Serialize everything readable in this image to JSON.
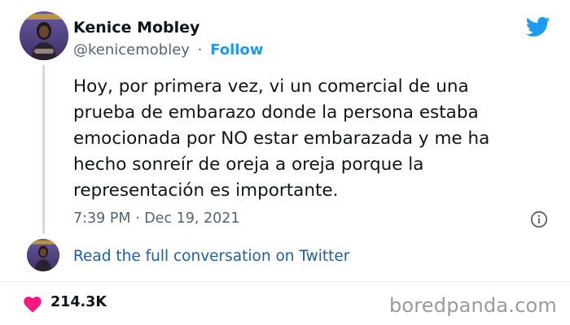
{
  "author": {
    "name": "Kenice Mobley",
    "handle": "@kenicemobley",
    "separator": "·",
    "follow_label": "Follow",
    "avatar_caption": "KENICE MOBLEY"
  },
  "tweet": {
    "text": "Hoy, por primera vez, vi un comercial de una prueba de embarazo donde la persona estaba emocionada por NO estar embarazada y me ha hecho sonreír de oreja a oreja porque la representación es importante.",
    "timestamp": "7:39 PM · Dec 19, 2021"
  },
  "conversation": {
    "link_label": "Read the full conversation on Twitter"
  },
  "stats": {
    "likes": "214.3K"
  },
  "watermark": "boredpanda.com",
  "icons": {
    "brand": "twitter-bird-icon",
    "info": "info-icon",
    "like": "heart-icon"
  },
  "colors": {
    "accent": "#1d9bf0",
    "link": "#1d5fa6",
    "heart": "#f91880",
    "muted": "#536471"
  }
}
